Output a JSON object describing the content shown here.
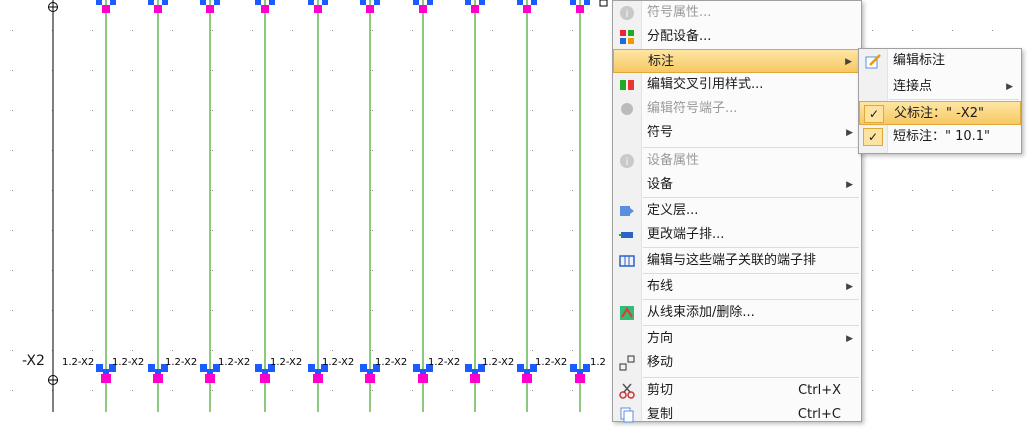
{
  "canvas": {
    "wire_color": "#3fa52a",
    "terminal_color": "#1a5cff",
    "marker_color": "#ff00cc",
    "left_label": "-X2",
    "terminal_labels": [
      "1.2-X2",
      "1.2-X2",
      "1.2-X2",
      "1.2-X2",
      "1.2-X2",
      "1.2-X2",
      "1.2-X2",
      "1.2-X2",
      "1.2-X2",
      "1.2-X2",
      "1.2"
    ]
  },
  "context_menu": {
    "items": [
      {
        "label": "符号属性...",
        "icon": "info-icon",
        "disabled": true
      },
      {
        "label": "分配设备...",
        "icon": "assign-device-icon"
      },
      {
        "label": "标注",
        "submenu": true,
        "highlighted": true
      },
      {
        "label": "编辑交叉引用样式...",
        "icon": "cross-reference-icon"
      },
      {
        "label": "编辑符号端子...",
        "icon": "symbol-terminal-icon",
        "disabled": true
      },
      {
        "label": "符号",
        "submenu": true
      },
      {
        "label": "设备属性",
        "icon": "info-icon",
        "disabled": true
      },
      {
        "label": "设备",
        "submenu": true
      },
      {
        "label": "定义层...",
        "icon": "layer-icon"
      },
      {
        "label": "更改端子排...",
        "icon": "terminal-strip-icon"
      },
      {
        "label": "编辑与这些端子关联的端子排",
        "icon": "terminal-strip-edit-icon"
      },
      {
        "label": "布线",
        "submenu": true
      },
      {
        "label": "从线束添加/删除...",
        "icon": "harness-icon"
      },
      {
        "label": "方向",
        "submenu": true
      },
      {
        "label": "移动",
        "icon": "move-icon"
      },
      {
        "label": "剪切",
        "icon": "scissors-icon",
        "shortcut": "Ctrl+X"
      },
      {
        "label": "复制",
        "icon": "copy-icon",
        "shortcut": "Ctrl+C"
      }
    ]
  },
  "submenu": {
    "items": [
      {
        "label": "编辑标注",
        "icon": "edit-annotation-icon"
      },
      {
        "label": "连接点",
        "submenu": true
      },
      {
        "label": "父标注：\" -X2\"",
        "checked": true,
        "highlighted": true
      },
      {
        "label": "短标注：\" 10.1\"",
        "checked": true
      }
    ]
  }
}
